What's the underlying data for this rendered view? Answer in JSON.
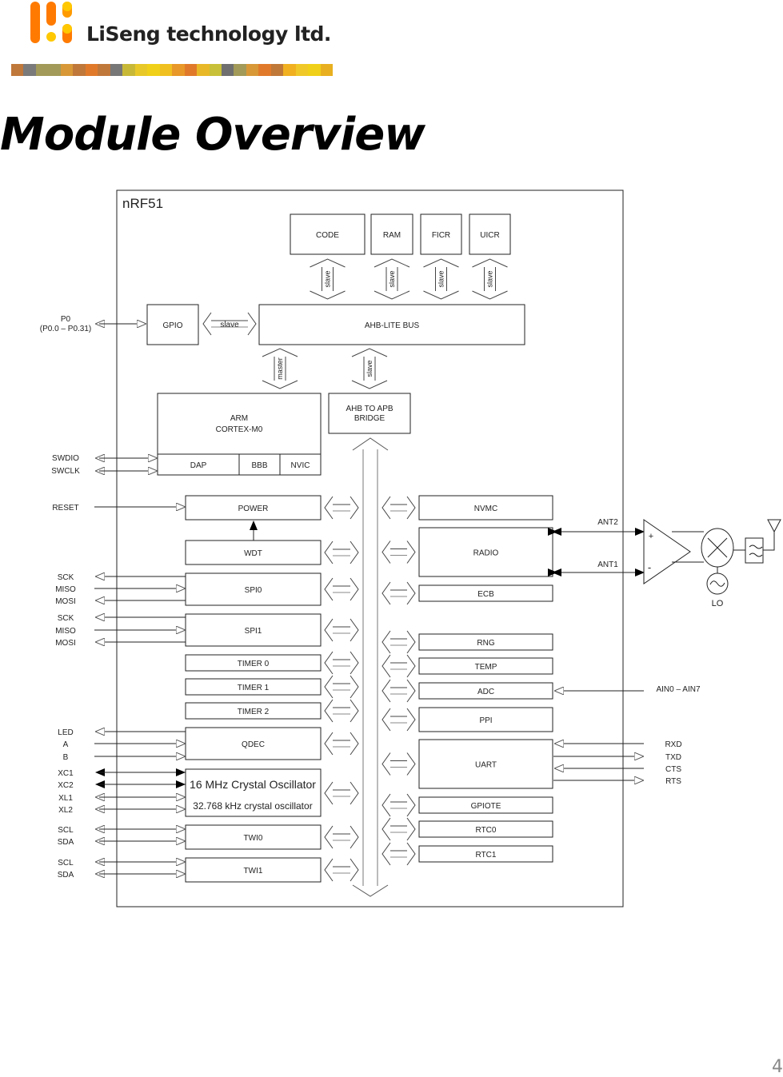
{
  "header": {
    "company": "LiSeng technology ltd.",
    "logo_colors": {
      "orange": "#ff7a00",
      "yellow": "#ffc800"
    },
    "stripe_colors": [
      "#c0773a",
      "#7a7a7a",
      "#a29a58",
      "#a29a58",
      "#d89838",
      "#c0773a",
      "#e07a2a",
      "#c0773a",
      "#777777",
      "#c8b838",
      "#e8c828",
      "#f0d018",
      "#f0c020",
      "#e89828",
      "#e07a2a",
      "#e8b828",
      "#c8c038",
      "#6f6f6f",
      "#a29a58",
      "#d89838",
      "#e07a2a",
      "#c07838",
      "#f0b020",
      "#f0c828",
      "#f0d018",
      "#e8b020"
    ]
  },
  "page": {
    "title": "Module Overview",
    "page_number": "4"
  },
  "diagram": {
    "chip_label": "nRF51",
    "memory": [
      "CODE",
      "RAM",
      "FICR",
      "UICR"
    ],
    "slave_label": "slave",
    "master_label": "master",
    "gpio": "GPIO",
    "ahb_bus": "AHB-LITE BUS",
    "bridge": [
      "AHB TO APB",
      "BRIDGE"
    ],
    "cpu": {
      "line1": "ARM",
      "line2": "CORTEX-M0",
      "dap": "DAP",
      "bbb": "BBB",
      "nvic": "NVIC"
    },
    "p0": [
      "P0",
      "(P0.0 – P0.31)"
    ],
    "debug_pins": [
      "SWDIO",
      "SWCLK"
    ],
    "left_blocks": {
      "power": "POWER",
      "wdt": "WDT",
      "spi0": "SPI0",
      "spi1": "SPI1",
      "timer0": "TIMER 0",
      "timer1": "TIMER 1",
      "timer2": "TIMER 2",
      "qdec": "QDEC",
      "osc16": "16 MHz Crystal Oscillator",
      "osc32": "32.768 kHz crystal oscillator",
      "twi0": "TWI0",
      "twi1": "TWI1"
    },
    "left_pins": {
      "reset": "RESET",
      "spi0": [
        "SCK",
        "MISO",
        "MOSI"
      ],
      "spi1": [
        "SCK",
        "MISO",
        "MOSI"
      ],
      "qdec": [
        "LED",
        "A",
        "B"
      ],
      "osc": [
        "XC1",
        "XC2",
        "XL1",
        "XL2"
      ],
      "twi0": [
        "SCL",
        "SDA"
      ],
      "twi1": [
        "SCL",
        "SDA"
      ]
    },
    "right_blocks": {
      "nvmc": "NVMC",
      "radio": "RADIO",
      "ecb": "ECB",
      "rng": "RNG",
      "temp": "TEMP",
      "adc": "ADC",
      "ppi": "PPI",
      "uart": "UART",
      "gpiote": "GPIOTE",
      "rtc0": "RTC0",
      "rtc1": "RTC1"
    },
    "right_pins": {
      "ant2": "ANT2",
      "ant1": "ANT1",
      "ain": "AIN0 – AIN7",
      "uart": [
        "RXD",
        "TXD",
        "CTS",
        "RTS"
      ],
      "lo": "LO",
      "plus": "+",
      "minus": "-"
    }
  }
}
